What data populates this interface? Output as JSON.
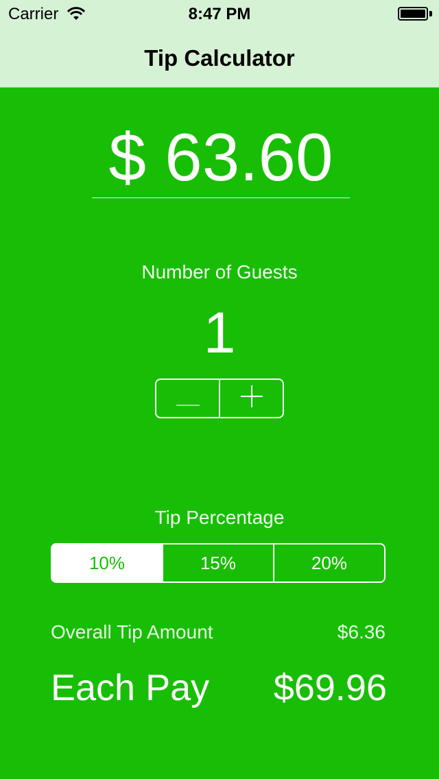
{
  "status_bar": {
    "carrier": "Carrier",
    "time": "8:47 PM",
    "wifi_icon": "wifi-icon",
    "battery_icon": "battery-icon"
  },
  "nav": {
    "title": "Tip Calculator"
  },
  "bill": {
    "amount": "$ 63.60"
  },
  "guests": {
    "label": "Number of Guests",
    "value": "1",
    "decrement": "—",
    "increment": "+"
  },
  "tip": {
    "label": "Tip Percentage",
    "options": [
      "10%",
      "15%",
      "20%"
    ],
    "selected": "10%"
  },
  "summary": {
    "overall_label": "Overall Tip Amount",
    "overall_value": "$6.36",
    "each_label": "Each Pay",
    "each_value": "$69.96"
  },
  "colors": {
    "background": "#18be05",
    "nav_background": "#d5f2d4",
    "text": "#ffffff"
  }
}
